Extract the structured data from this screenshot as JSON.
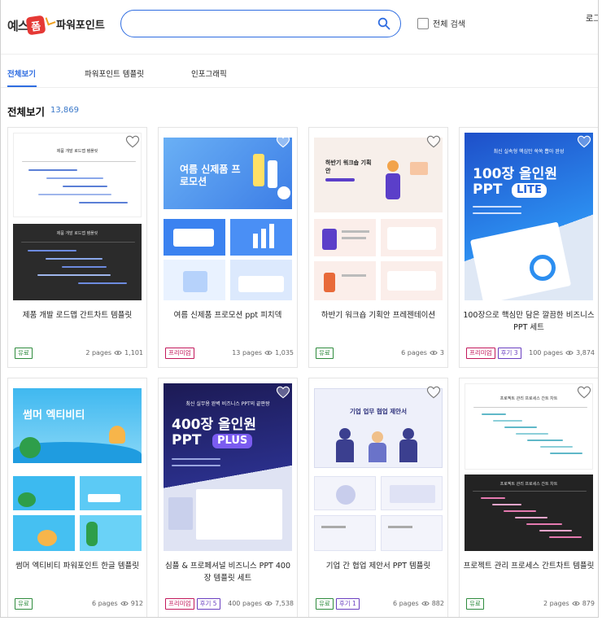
{
  "header": {
    "logo_text": "예스",
    "logo_badge": "폼",
    "brand": "파워포인트",
    "search_placeholder": "",
    "fullsearch_label": "전체 검색",
    "login": "로그인"
  },
  "tabs": [
    {
      "label": "전체보기",
      "active": true
    },
    {
      "label": "파워포인트 템플릿",
      "active": false
    },
    {
      "label": "인포그래픽",
      "active": false
    }
  ],
  "section": {
    "title": "전체보기",
    "count": "13,869"
  },
  "cards": [
    {
      "title": "제품 개발 로드맵 간트차트 템플릿",
      "badges": [
        {
          "label": "유료",
          "color": "green"
        }
      ],
      "pages": "2 pages",
      "views": "1,101",
      "thumb_top": "제품 개발 로드맵 템플릿",
      "thumb_bottom": "제품 개발 로드맵 템플릿"
    },
    {
      "title": "여름 신제품 프로모션 ppt 피치덱",
      "badges": [
        {
          "label": "프리미엄",
          "color": "pink"
        }
      ],
      "pages": "13 pages",
      "views": "1,035",
      "thumb_top": "여름 신제품 프로모션"
    },
    {
      "title": "하반기 워크숍 기획안 프레젠테이션",
      "badges": [
        {
          "label": "유료",
          "color": "green"
        }
      ],
      "pages": "6 pages",
      "views": "3",
      "thumb_top": "하반기 워크숍 기획안"
    },
    {
      "title": "100장으로 핵심만 담은 깔끔한 비즈니스 PPT 세트",
      "badges": [
        {
          "label": "프리미엄",
          "color": "pink"
        },
        {
          "label": "후기 3",
          "color": "purple"
        }
      ],
      "pages": "100 pages",
      "views": "3,874",
      "thumb_kicker": "최신 실속형 핵심만 쏙쏙 뽑아 완성",
      "thumb_main": "100장 올인원",
      "thumb_sub": "PPT",
      "thumb_pill": "LITE"
    },
    {
      "title": "썸머 엑티비티 파워포인트 한글 템플릿",
      "badges": [
        {
          "label": "유료",
          "color": "green"
        }
      ],
      "pages": "6 pages",
      "views": "912",
      "thumb_top": "썸머 엑티비티"
    },
    {
      "title": "심플 & 프로페셔널 비즈니스 PPT 400장 템플릿 세트",
      "badges": [
        {
          "label": "프리미엄",
          "color": "pink"
        },
        {
          "label": "후기 5",
          "color": "purple"
        }
      ],
      "pages": "400 pages",
      "views": "7,538",
      "thumb_kicker": "최신 실무용 완벽 비즈니스 PPT의 끝판왕",
      "thumb_main": "400장 올인원",
      "thumb_sub": "PPT",
      "thumb_pill": "PLUS"
    },
    {
      "title": "기업 간 협업 제안서 PPT 템플릿",
      "badges": [
        {
          "label": "유료",
          "color": "green"
        },
        {
          "label": "후기 1",
          "color": "purple"
        }
      ],
      "pages": "6 pages",
      "views": "882",
      "thumb_top": "기업 업무 협업 제안서"
    },
    {
      "title": "프로젝트 관리 프로세스 간트차트 템플릿",
      "badges": [
        {
          "label": "유료",
          "color": "green"
        }
      ],
      "pages": "2 pages",
      "views": "879",
      "thumb_top": "프로젝트 관리 프로세스 간트 차트"
    }
  ],
  "colors": {
    "accent": "#2f6de1",
    "count": "#3a78c9"
  }
}
